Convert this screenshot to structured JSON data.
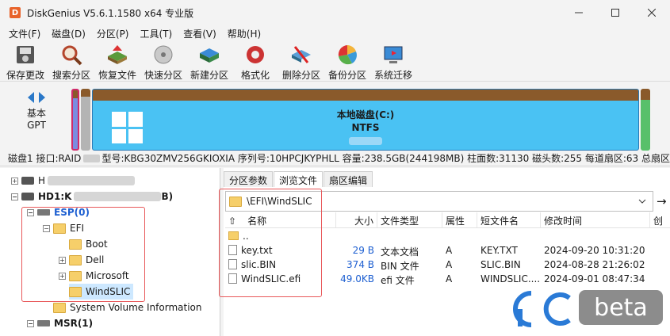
{
  "window": {
    "title": "DiskGenius V5.6.1.1580 x64 专业版",
    "app_icon_letter": "D"
  },
  "menu": [
    "文件(F)",
    "磁盘(D)",
    "分区(P)",
    "工具(T)",
    "查看(V)",
    "帮助(H)"
  ],
  "toolbar": [
    {
      "label": "保存更改",
      "icon": "save-icon"
    },
    {
      "label": "搜索分区",
      "icon": "search-partition-icon"
    },
    {
      "label": "恢复文件",
      "icon": "recover-files-icon"
    },
    {
      "label": "快速分区",
      "icon": "quick-partition-icon"
    },
    {
      "label": "新建分区",
      "icon": "new-partition-icon"
    },
    {
      "label": "格式化",
      "icon": "format-icon"
    },
    {
      "label": "删除分区",
      "icon": "delete-partition-icon"
    },
    {
      "label": "备份分区",
      "icon": "backup-partition-icon"
    },
    {
      "label": "系统迁移",
      "icon": "system-migrate-icon"
    }
  ],
  "disk": {
    "type_line1": "基本",
    "type_line2": "GPT",
    "c_name": "本地磁盘(C:)",
    "c_fs": "NTFS"
  },
  "info_line": {
    "part1": "磁盘1 接口:RAID",
    "part2": "型号:KBG30ZMV256GKIOXIA  序列号:10HPCJKYPHLL  容量:238.5GB(244198MB)  柱面数:31130  磁头数:255  每道扇区:63  总扇区"
  },
  "tree": {
    "hd0": "H",
    "hd1": "HD1:K",
    "hd1_suffix": "B)",
    "esp": "ESP(0)",
    "efi": "EFI",
    "boot": "Boot",
    "dell": "Dell",
    "microsoft": "Microsoft",
    "windslic": "WindSLIC",
    "svi": "System Volume Information",
    "msr": "MSR(1)"
  },
  "tabs": [
    "分区参数",
    "浏览文件",
    "扇区编辑"
  ],
  "path": "\\EFI\\WindSLIC",
  "columns": [
    "名称",
    "大小",
    "文件类型",
    "属性",
    "短文件名",
    "修改时间",
    "创"
  ],
  "files": [
    {
      "name": "..",
      "size": "",
      "type": "",
      "attr": "",
      "short": "",
      "mtime": ""
    },
    {
      "name": "key.txt",
      "size": "29 B",
      "type": "文本文档",
      "attr": "A",
      "short": "KEY.TXT",
      "mtime": "2024-09-20 10:31:20"
    },
    {
      "name": "slic.BIN",
      "size": "374 B",
      "type": "BIN 文件",
      "attr": "A",
      "short": "SLIC.BIN",
      "mtime": "2024-08-28 21:26:02"
    },
    {
      "name": "WindSLIC.efi",
      "size": "49.0KB",
      "type": "efi 文件",
      "attr": "A",
      "short": "WINDSLIC....",
      "mtime": "2024-09-01 08:47:34"
    }
  ],
  "watermark": {
    "logo": "cnbeta-logo-icon",
    "text": "beta"
  },
  "colors": {
    "accent_blue": "#1d5fd1",
    "highlight_red": "#e8585a",
    "c_partition": "#4ac2f3"
  }
}
